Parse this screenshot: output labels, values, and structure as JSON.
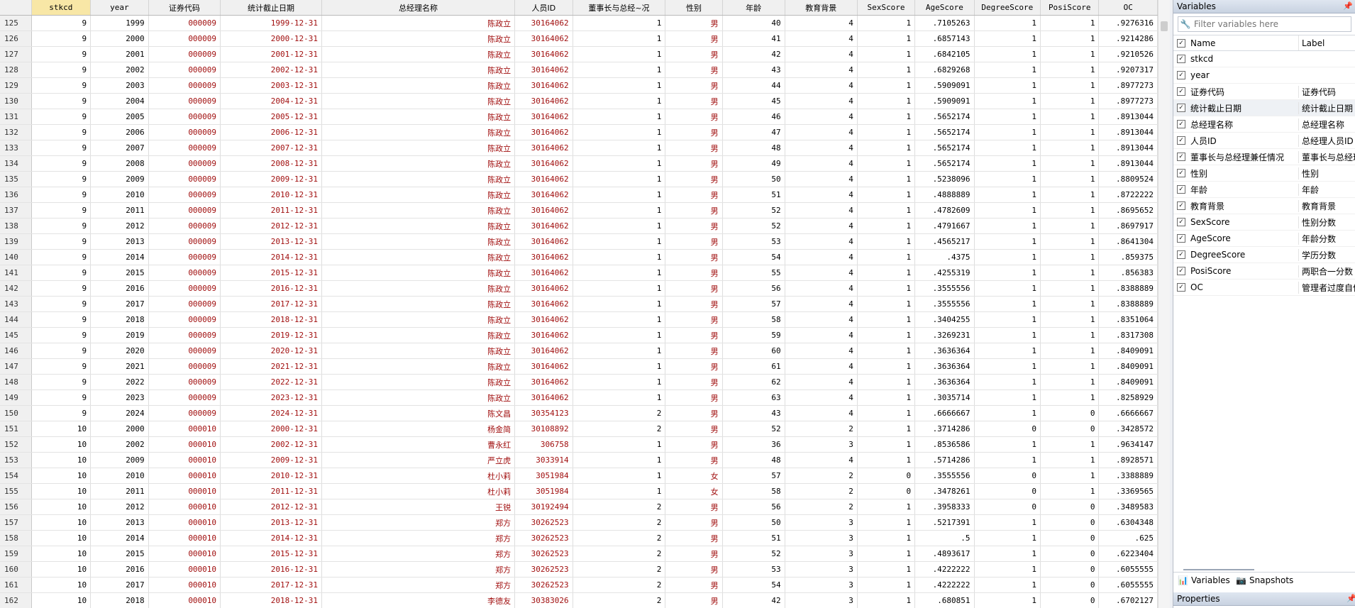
{
  "grid": {
    "columns": [
      {
        "name": "stkcd",
        "w": 80,
        "selected": true
      },
      {
        "name": "year",
        "w": 78
      },
      {
        "name": "证券代码",
        "w": 98
      },
      {
        "name": "统计截止日期",
        "w": 140
      },
      {
        "name": "总经理名称",
        "w": 274
      },
      {
        "name": "人员ID",
        "w": 77
      },
      {
        "name": "董事长与总经~况",
        "w": 127
      },
      {
        "name": "性别",
        "w": 77
      },
      {
        "name": "年龄",
        "w": 85
      },
      {
        "name": "教育背景",
        "w": 99
      },
      {
        "name": "SexScore",
        "w": 77
      },
      {
        "name": "AgeScore",
        "w": 79
      },
      {
        "name": "DegreeScore",
        "w": 89
      },
      {
        "name": "PosiScore",
        "w": 78
      },
      {
        "name": "OC",
        "w": 78
      }
    ],
    "rows": [
      [
        "125",
        "9",
        "1999",
        "000009",
        "1999-12-31",
        "陈政立",
        "30164062",
        "1",
        "男",
        "40",
        "4",
        "1",
        ".7105263",
        "1",
        "1",
        ".9276316"
      ],
      [
        "126",
        "9",
        "2000",
        "000009",
        "2000-12-31",
        "陈政立",
        "30164062",
        "1",
        "男",
        "41",
        "4",
        "1",
        ".6857143",
        "1",
        "1",
        ".9214286"
      ],
      [
        "127",
        "9",
        "2001",
        "000009",
        "2001-12-31",
        "陈政立",
        "30164062",
        "1",
        "男",
        "42",
        "4",
        "1",
        ".6842105",
        "1",
        "1",
        ".9210526"
      ],
      [
        "128",
        "9",
        "2002",
        "000009",
        "2002-12-31",
        "陈政立",
        "30164062",
        "1",
        "男",
        "43",
        "4",
        "1",
        ".6829268",
        "1",
        "1",
        ".9207317"
      ],
      [
        "129",
        "9",
        "2003",
        "000009",
        "2003-12-31",
        "陈政立",
        "30164062",
        "1",
        "男",
        "44",
        "4",
        "1",
        ".5909091",
        "1",
        "1",
        ".8977273"
      ],
      [
        "130",
        "9",
        "2004",
        "000009",
        "2004-12-31",
        "陈政立",
        "30164062",
        "1",
        "男",
        "45",
        "4",
        "1",
        ".5909091",
        "1",
        "1",
        ".8977273"
      ],
      [
        "131",
        "9",
        "2005",
        "000009",
        "2005-12-31",
        "陈政立",
        "30164062",
        "1",
        "男",
        "46",
        "4",
        "1",
        ".5652174",
        "1",
        "1",
        ".8913044"
      ],
      [
        "132",
        "9",
        "2006",
        "000009",
        "2006-12-31",
        "陈政立",
        "30164062",
        "1",
        "男",
        "47",
        "4",
        "1",
        ".5652174",
        "1",
        "1",
        ".8913044"
      ],
      [
        "133",
        "9",
        "2007",
        "000009",
        "2007-12-31",
        "陈政立",
        "30164062",
        "1",
        "男",
        "48",
        "4",
        "1",
        ".5652174",
        "1",
        "1",
        ".8913044"
      ],
      [
        "134",
        "9",
        "2008",
        "000009",
        "2008-12-31",
        "陈政立",
        "30164062",
        "1",
        "男",
        "49",
        "4",
        "1",
        ".5652174",
        "1",
        "1",
        ".8913044"
      ],
      [
        "135",
        "9",
        "2009",
        "000009",
        "2009-12-31",
        "陈政立",
        "30164062",
        "1",
        "男",
        "50",
        "4",
        "1",
        ".5238096",
        "1",
        "1",
        ".8809524"
      ],
      [
        "136",
        "9",
        "2010",
        "000009",
        "2010-12-31",
        "陈政立",
        "30164062",
        "1",
        "男",
        "51",
        "4",
        "1",
        ".4888889",
        "1",
        "1",
        ".8722222"
      ],
      [
        "137",
        "9",
        "2011",
        "000009",
        "2011-12-31",
        "陈政立",
        "30164062",
        "1",
        "男",
        "52",
        "4",
        "1",
        ".4782609",
        "1",
        "1",
        ".8695652"
      ],
      [
        "138",
        "9",
        "2012",
        "000009",
        "2012-12-31",
        "陈政立",
        "30164062",
        "1",
        "男",
        "52",
        "4",
        "1",
        ".4791667",
        "1",
        "1",
        ".8697917"
      ],
      [
        "139",
        "9",
        "2013",
        "000009",
        "2013-12-31",
        "陈政立",
        "30164062",
        "1",
        "男",
        "53",
        "4",
        "1",
        ".4565217",
        "1",
        "1",
        ".8641304"
      ],
      [
        "140",
        "9",
        "2014",
        "000009",
        "2014-12-31",
        "陈政立",
        "30164062",
        "1",
        "男",
        "54",
        "4",
        "1",
        ".4375",
        "1",
        "1",
        ".859375"
      ],
      [
        "141",
        "9",
        "2015",
        "000009",
        "2015-12-31",
        "陈政立",
        "30164062",
        "1",
        "男",
        "55",
        "4",
        "1",
        ".4255319",
        "1",
        "1",
        ".856383"
      ],
      [
        "142",
        "9",
        "2016",
        "000009",
        "2016-12-31",
        "陈政立",
        "30164062",
        "1",
        "男",
        "56",
        "4",
        "1",
        ".3555556",
        "1",
        "1",
        ".8388889"
      ],
      [
        "143",
        "9",
        "2017",
        "000009",
        "2017-12-31",
        "陈政立",
        "30164062",
        "1",
        "男",
        "57",
        "4",
        "1",
        ".3555556",
        "1",
        "1",
        ".8388889"
      ],
      [
        "144",
        "9",
        "2018",
        "000009",
        "2018-12-31",
        "陈政立",
        "30164062",
        "1",
        "男",
        "58",
        "4",
        "1",
        ".3404255",
        "1",
        "1",
        ".8351064"
      ],
      [
        "145",
        "9",
        "2019",
        "000009",
        "2019-12-31",
        "陈政立",
        "30164062",
        "1",
        "男",
        "59",
        "4",
        "1",
        ".3269231",
        "1",
        "1",
        ".8317308"
      ],
      [
        "146",
        "9",
        "2020",
        "000009",
        "2020-12-31",
        "陈政立",
        "30164062",
        "1",
        "男",
        "60",
        "4",
        "1",
        ".3636364",
        "1",
        "1",
        ".8409091"
      ],
      [
        "147",
        "9",
        "2021",
        "000009",
        "2021-12-31",
        "陈政立",
        "30164062",
        "1",
        "男",
        "61",
        "4",
        "1",
        ".3636364",
        "1",
        "1",
        ".8409091"
      ],
      [
        "148",
        "9",
        "2022",
        "000009",
        "2022-12-31",
        "陈政立",
        "30164062",
        "1",
        "男",
        "62",
        "4",
        "1",
        ".3636364",
        "1",
        "1",
        ".8409091"
      ],
      [
        "149",
        "9",
        "2023",
        "000009",
        "2023-12-31",
        "陈政立",
        "30164062",
        "1",
        "男",
        "63",
        "4",
        "1",
        ".3035714",
        "1",
        "1",
        ".8258929"
      ],
      [
        "150",
        "9",
        "2024",
        "000009",
        "2024-12-31",
        "陈文昌",
        "30354123",
        "2",
        "男",
        "43",
        "4",
        "1",
        ".6666667",
        "1",
        "0",
        ".6666667"
      ],
      [
        "151",
        "10",
        "2000",
        "000010",
        "2000-12-31",
        "杨金简",
        "30108892",
        "2",
        "男",
        "52",
        "2",
        "1",
        ".3714286",
        "0",
        "0",
        ".3428572"
      ],
      [
        "152",
        "10",
        "2002",
        "000010",
        "2002-12-31",
        "曹永红",
        "306758",
        "1",
        "男",
        "36",
        "3",
        "1",
        ".8536586",
        "1",
        "1",
        ".9634147"
      ],
      [
        "153",
        "10",
        "2009",
        "000010",
        "2009-12-31",
        "严立虎",
        "3033914",
        "1",
        "男",
        "48",
        "4",
        "1",
        ".5714286",
        "1",
        "1",
        ".8928571"
      ],
      [
        "154",
        "10",
        "2010",
        "000010",
        "2010-12-31",
        "杜小莉",
        "3051984",
        "1",
        "女",
        "57",
        "2",
        "0",
        ".3555556",
        "0",
        "1",
        ".3388889"
      ],
      [
        "155",
        "10",
        "2011",
        "000010",
        "2011-12-31",
        "杜小莉",
        "3051984",
        "1",
        "女",
        "58",
        "2",
        "0",
        ".3478261",
        "0",
        "1",
        ".3369565"
      ],
      [
        "156",
        "10",
        "2012",
        "000010",
        "2012-12-31",
        "王锐",
        "30192494",
        "2",
        "男",
        "56",
        "2",
        "1",
        ".3958333",
        "0",
        "0",
        ".3489583"
      ],
      [
        "157",
        "10",
        "2013",
        "000010",
        "2013-12-31",
        "郑方",
        "30262523",
        "2",
        "男",
        "50",
        "3",
        "1",
        ".5217391",
        "1",
        "0",
        ".6304348"
      ],
      [
        "158",
        "10",
        "2014",
        "000010",
        "2014-12-31",
        "郑方",
        "30262523",
        "2",
        "男",
        "51",
        "3",
        "1",
        ".5",
        "1",
        "0",
        ".625"
      ],
      [
        "159",
        "10",
        "2015",
        "000010",
        "2015-12-31",
        "郑方",
        "30262523",
        "2",
        "男",
        "52",
        "3",
        "1",
        ".4893617",
        "1",
        "0",
        ".6223404"
      ],
      [
        "160",
        "10",
        "2016",
        "000010",
        "2016-12-31",
        "郑方",
        "30262523",
        "2",
        "男",
        "53",
        "3",
        "1",
        ".4222222",
        "1",
        "0",
        ".6055555"
      ],
      [
        "161",
        "10",
        "2017",
        "000010",
        "2017-12-31",
        "郑方",
        "30262523",
        "2",
        "男",
        "54",
        "3",
        "1",
        ".4222222",
        "1",
        "0",
        ".6055555"
      ],
      [
        "162",
        "10",
        "2018",
        "000010",
        "2018-12-31",
        "李德友",
        "30383026",
        "2",
        "男",
        "42",
        "3",
        "1",
        ".680851",
        "1",
        "0",
        ".6702127"
      ]
    ]
  },
  "panel": {
    "title": "Variables",
    "pin_glyph": "📌",
    "filter_placeholder": "Filter variables here",
    "hdr_name": "Name",
    "hdr_label": "Label",
    "variables": [
      {
        "name": "stkcd",
        "label": ""
      },
      {
        "name": "year",
        "label": ""
      },
      {
        "name": "证券代码",
        "label": "证券代码"
      },
      {
        "name": "统计截止日期",
        "label": "统计截止日期",
        "highlight": true
      },
      {
        "name": "总经理名称",
        "label": "总经理名称"
      },
      {
        "name": "人员ID",
        "label": "总经理人员ID"
      },
      {
        "name": "董事长与总经理兼任情况",
        "label": "董事长与总经理"
      },
      {
        "name": "性别",
        "label": "性别"
      },
      {
        "name": "年龄",
        "label": "年龄"
      },
      {
        "name": "教育背景",
        "label": "教育背景"
      },
      {
        "name": "SexScore",
        "label": "性别分数"
      },
      {
        "name": "AgeScore",
        "label": "年龄分数"
      },
      {
        "name": "DegreeScore",
        "label": "学历分数"
      },
      {
        "name": "PosiScore",
        "label": "两职合一分数"
      },
      {
        "name": "OC",
        "label": "管理者过度自信"
      }
    ],
    "tabs": {
      "variables": "Variables",
      "snapshots": "Snapshots"
    },
    "properties_title": "Properties"
  }
}
